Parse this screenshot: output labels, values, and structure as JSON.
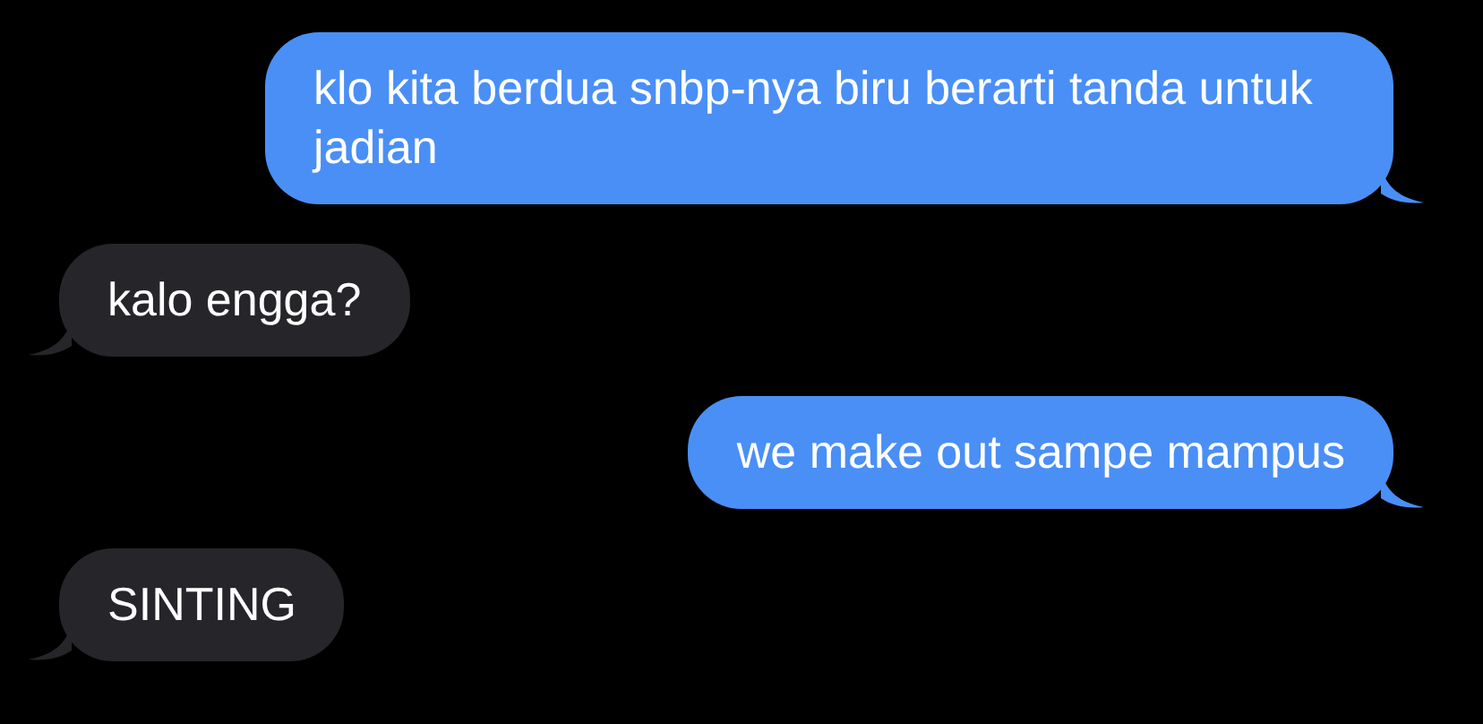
{
  "messages": [
    {
      "kind": "sent",
      "text": "klo kita berdua snbp-nya biru berarti tanda untuk jadian"
    },
    {
      "kind": "received",
      "text": "kalo engga?"
    },
    {
      "kind": "sent",
      "text": "we make out sampe mampus"
    },
    {
      "kind": "received",
      "text": "SINTING"
    }
  ]
}
